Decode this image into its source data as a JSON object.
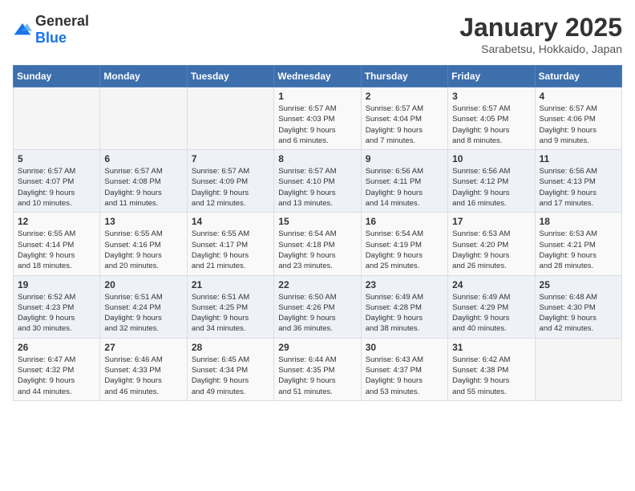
{
  "header": {
    "logo": {
      "general": "General",
      "blue": "Blue"
    },
    "title": "January 2025",
    "subtitle": "Sarabetsu, Hokkaido, Japan"
  },
  "weekdays": [
    "Sunday",
    "Monday",
    "Tuesday",
    "Wednesday",
    "Thursday",
    "Friday",
    "Saturday"
  ],
  "weeks": [
    [
      {
        "day": "",
        "info": ""
      },
      {
        "day": "",
        "info": ""
      },
      {
        "day": "",
        "info": ""
      },
      {
        "day": "1",
        "info": "Sunrise: 6:57 AM\nSunset: 4:03 PM\nDaylight: 9 hours\nand 6 minutes."
      },
      {
        "day": "2",
        "info": "Sunrise: 6:57 AM\nSunset: 4:04 PM\nDaylight: 9 hours\nand 7 minutes."
      },
      {
        "day": "3",
        "info": "Sunrise: 6:57 AM\nSunset: 4:05 PM\nDaylight: 9 hours\nand 8 minutes."
      },
      {
        "day": "4",
        "info": "Sunrise: 6:57 AM\nSunset: 4:06 PM\nDaylight: 9 hours\nand 9 minutes."
      }
    ],
    [
      {
        "day": "5",
        "info": "Sunrise: 6:57 AM\nSunset: 4:07 PM\nDaylight: 9 hours\nand 10 minutes."
      },
      {
        "day": "6",
        "info": "Sunrise: 6:57 AM\nSunset: 4:08 PM\nDaylight: 9 hours\nand 11 minutes."
      },
      {
        "day": "7",
        "info": "Sunrise: 6:57 AM\nSunset: 4:09 PM\nDaylight: 9 hours\nand 12 minutes."
      },
      {
        "day": "8",
        "info": "Sunrise: 6:57 AM\nSunset: 4:10 PM\nDaylight: 9 hours\nand 13 minutes."
      },
      {
        "day": "9",
        "info": "Sunrise: 6:56 AM\nSunset: 4:11 PM\nDaylight: 9 hours\nand 14 minutes."
      },
      {
        "day": "10",
        "info": "Sunrise: 6:56 AM\nSunset: 4:12 PM\nDaylight: 9 hours\nand 16 minutes."
      },
      {
        "day": "11",
        "info": "Sunrise: 6:56 AM\nSunset: 4:13 PM\nDaylight: 9 hours\nand 17 minutes."
      }
    ],
    [
      {
        "day": "12",
        "info": "Sunrise: 6:55 AM\nSunset: 4:14 PM\nDaylight: 9 hours\nand 18 minutes."
      },
      {
        "day": "13",
        "info": "Sunrise: 6:55 AM\nSunset: 4:16 PM\nDaylight: 9 hours\nand 20 minutes."
      },
      {
        "day": "14",
        "info": "Sunrise: 6:55 AM\nSunset: 4:17 PM\nDaylight: 9 hours\nand 21 minutes."
      },
      {
        "day": "15",
        "info": "Sunrise: 6:54 AM\nSunset: 4:18 PM\nDaylight: 9 hours\nand 23 minutes."
      },
      {
        "day": "16",
        "info": "Sunrise: 6:54 AM\nSunset: 4:19 PM\nDaylight: 9 hours\nand 25 minutes."
      },
      {
        "day": "17",
        "info": "Sunrise: 6:53 AM\nSunset: 4:20 PM\nDaylight: 9 hours\nand 26 minutes."
      },
      {
        "day": "18",
        "info": "Sunrise: 6:53 AM\nSunset: 4:21 PM\nDaylight: 9 hours\nand 28 minutes."
      }
    ],
    [
      {
        "day": "19",
        "info": "Sunrise: 6:52 AM\nSunset: 4:23 PM\nDaylight: 9 hours\nand 30 minutes."
      },
      {
        "day": "20",
        "info": "Sunrise: 6:51 AM\nSunset: 4:24 PM\nDaylight: 9 hours\nand 32 minutes."
      },
      {
        "day": "21",
        "info": "Sunrise: 6:51 AM\nSunset: 4:25 PM\nDaylight: 9 hours\nand 34 minutes."
      },
      {
        "day": "22",
        "info": "Sunrise: 6:50 AM\nSunset: 4:26 PM\nDaylight: 9 hours\nand 36 minutes."
      },
      {
        "day": "23",
        "info": "Sunrise: 6:49 AM\nSunset: 4:28 PM\nDaylight: 9 hours\nand 38 minutes."
      },
      {
        "day": "24",
        "info": "Sunrise: 6:49 AM\nSunset: 4:29 PM\nDaylight: 9 hours\nand 40 minutes."
      },
      {
        "day": "25",
        "info": "Sunrise: 6:48 AM\nSunset: 4:30 PM\nDaylight: 9 hours\nand 42 minutes."
      }
    ],
    [
      {
        "day": "26",
        "info": "Sunrise: 6:47 AM\nSunset: 4:32 PM\nDaylight: 9 hours\nand 44 minutes."
      },
      {
        "day": "27",
        "info": "Sunrise: 6:46 AM\nSunset: 4:33 PM\nDaylight: 9 hours\nand 46 minutes."
      },
      {
        "day": "28",
        "info": "Sunrise: 6:45 AM\nSunset: 4:34 PM\nDaylight: 9 hours\nand 49 minutes."
      },
      {
        "day": "29",
        "info": "Sunrise: 6:44 AM\nSunset: 4:35 PM\nDaylight: 9 hours\nand 51 minutes."
      },
      {
        "day": "30",
        "info": "Sunrise: 6:43 AM\nSunset: 4:37 PM\nDaylight: 9 hours\nand 53 minutes."
      },
      {
        "day": "31",
        "info": "Sunrise: 6:42 AM\nSunset: 4:38 PM\nDaylight: 9 hours\nand 55 minutes."
      },
      {
        "day": "",
        "info": ""
      }
    ]
  ]
}
